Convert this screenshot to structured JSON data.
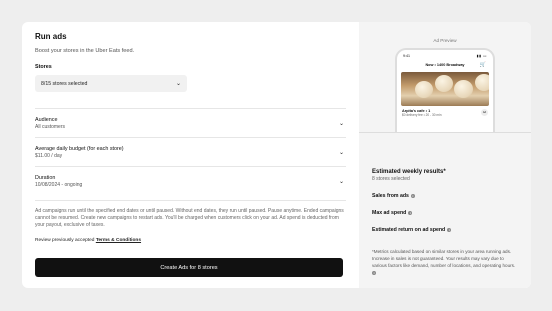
{
  "form": {
    "title": "Run ads",
    "subtitle": "Boost your stores in the Uber Eats feed.",
    "stores_label": "Stores",
    "stores_value": "8/15 stores selected",
    "audience": {
      "label": "Audience",
      "value": "All customers"
    },
    "budget": {
      "label": "Average daily budget (for each store)",
      "value": "$11.00 / day"
    },
    "duration": {
      "label": "Duration",
      "value": "10/08/2024 - ongoing"
    },
    "note": "Ad campaigns run until the specified end dates or until paused. Without end dates, they run until paused. Pause anytime. Ended campaigns cannot be resumed. Create new campaigns to restart ads. You'll be charged when customers click on your ad. Ad spend is deducted from your payout, exclusive of taxes.",
    "review_prefix": "Review previously accepted",
    "review_link": "Terms & Conditions",
    "cta": "Create Ads for 8 stores"
  },
  "preview": {
    "heading": "Ad Preview",
    "time": "9:41",
    "location": "Now • 1400 Broadway",
    "store_name": "Arpita's cafe • 1",
    "store_meta": "$0 delivery fee • 20 - 30 min",
    "badge": "Ad"
  },
  "estimates": {
    "title": "Estimated weekly results*",
    "subtitle": "8 stores selected",
    "metrics": [
      "Sales from ads",
      "Max ad spend",
      "Estimated return on ad spend"
    ],
    "footnote": "*Metrics calculated based on similar stores in your area running ads. Increase in sales is not guaranteed. Your results may vary due to various factors like demand, number of locations, and operating hours."
  }
}
